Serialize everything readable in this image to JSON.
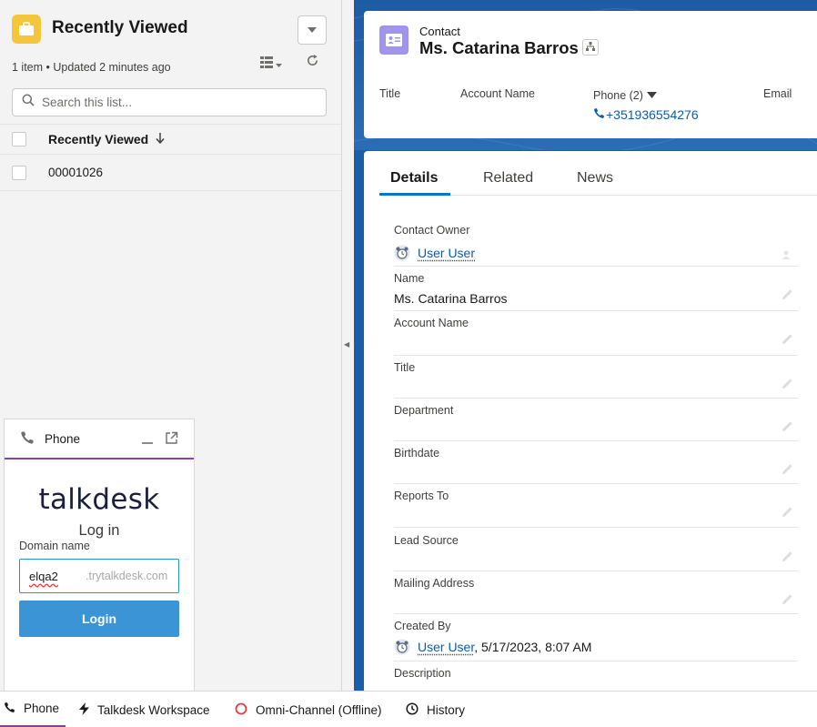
{
  "list_view": {
    "title": "Recently Viewed",
    "meta": "1 item • Updated 2 minutes ago",
    "search_placeholder": "Search this list...",
    "column_header": "Recently Viewed",
    "rows": [
      "00001026"
    ]
  },
  "phone_widget": {
    "title": "Phone",
    "logo": "talkdesk",
    "login_title": "Log in",
    "domain_label": "Domain name",
    "domain_value": "elqa2",
    "domain_suffix": ".trytalkdesk.com",
    "login_button": "Login"
  },
  "contact": {
    "type_label": "Contact",
    "name": "Ms. Catarina Barros",
    "highlights": {
      "title_label": "Title",
      "account_label": "Account Name",
      "phone_label": "Phone (2)",
      "phone_value": "+351936554276",
      "email_label": "Email"
    },
    "tabs": [
      "Details",
      "Related",
      "News"
    ],
    "fields": {
      "owner_label": "Contact Owner",
      "owner_value": "User User",
      "name_label": "Name",
      "name_value": "Ms. Catarina Barros",
      "account_label": "Account Name",
      "title_label": "Title",
      "department_label": "Department",
      "birthdate_label": "Birthdate",
      "reports_to_label": "Reports To",
      "lead_source_label": "Lead Source",
      "mailing_address_label": "Mailing Address",
      "created_by_label": "Created By",
      "created_by_user": "User User",
      "created_by_date": ", 5/17/2023, 8:07 AM",
      "description_label": "Description"
    }
  },
  "utility_bar": {
    "items": [
      "Phone",
      "Talkdesk Workspace",
      "Omni-Channel (Offline)",
      "History"
    ]
  },
  "colors": {
    "accent_blue": "#0176d3",
    "link_blue": "#0b5cab",
    "contact_icon": "#a094ed",
    "list_icon": "#f4c73a",
    "talkdesk_purple": "#8a3fa8",
    "login_button": "#3b94d6",
    "omni_offline": "#e03e3e"
  },
  "icons": [
    "briefcase-icon",
    "chevron-down-icon",
    "table-display-icon",
    "refresh-icon",
    "search-icon",
    "arrow-down-icon",
    "phone-icon",
    "minimize-icon",
    "popout-icon",
    "contact-card-icon",
    "hierarchy-icon",
    "pencil-icon",
    "avatar-icon",
    "lightning-icon",
    "omni-status-icon",
    "clock-icon"
  ]
}
